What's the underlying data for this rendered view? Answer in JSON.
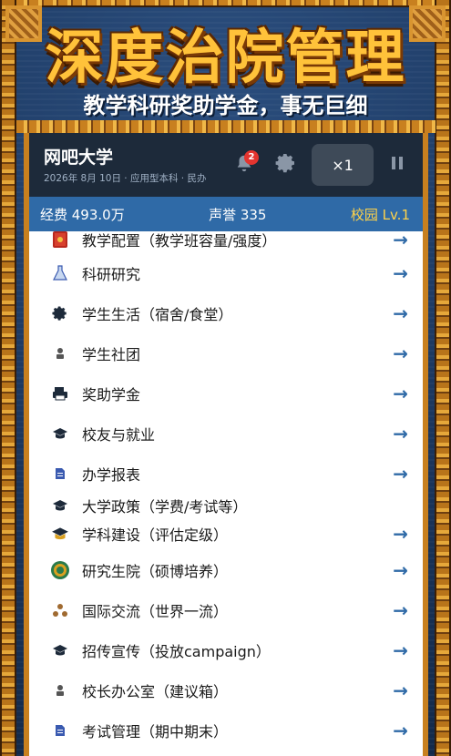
{
  "banner": {
    "title": "深度治院管理",
    "subtitle": "教学科研奖助学金，事无巨细"
  },
  "header": {
    "app_name": "网吧大学",
    "meta": "2026年 8月 10日 · 应用型本科 · 民办",
    "notification_count": "2",
    "speed_label": "×1"
  },
  "stats": {
    "funds": "经费 493.0万",
    "reputation": "声誉 335",
    "campus": "校园 Lv.1"
  },
  "menu": {
    "arrow": "→",
    "items": [
      {
        "label": "教学配置（教学班容量/强度）",
        "icon": "book-icon"
      },
      {
        "label": "科研研究",
        "icon": "flask-icon"
      },
      {
        "label": "学生生活（宿舍/食堂）",
        "icon": "gear-icon"
      },
      {
        "label": "学生社团",
        "icon": "person-icon"
      },
      {
        "label": "奖助学金",
        "icon": "printer-icon"
      },
      {
        "label": "校友与就业",
        "icon": "graduation-cap-icon"
      },
      {
        "label": "办学报表",
        "icon": "document-icon"
      },
      {
        "label": "大学政策（学费/考试等）",
        "icon": "graduation-cap-icon"
      },
      {
        "label": "学科建设（评估定级）",
        "icon": "graduation-cap-icon"
      },
      {
        "label": "研究生院（硕博培养）",
        "icon": "medal-icon"
      },
      {
        "label": "国际交流（世界一流）",
        "icon": "network-icon"
      },
      {
        "label": "招传宣传（投放campaign）",
        "icon": "graduation-cap-icon"
      },
      {
        "label": "校长办公室（建议箱）",
        "icon": "person-icon"
      },
      {
        "label": "考试管理（期中期末）",
        "icon": "document-icon"
      }
    ]
  },
  "colors": {
    "accent": "#2f6aa7",
    "gold": "#ffc23a",
    "header_bg": "#1d2a3a"
  }
}
